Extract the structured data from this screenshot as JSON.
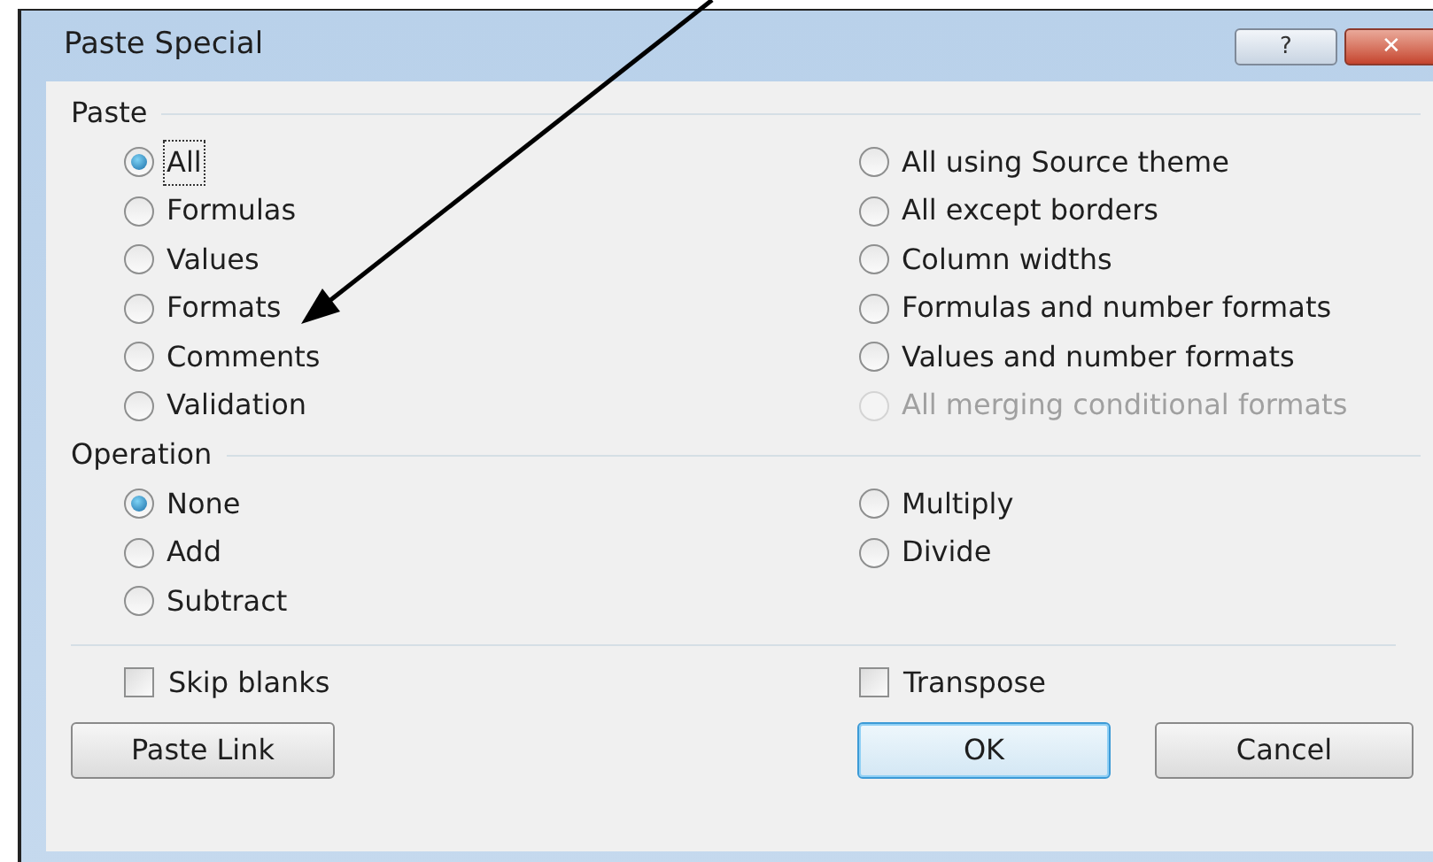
{
  "window": {
    "title": "Paste Special",
    "help_button": "?",
    "close_button": "✕"
  },
  "paste": {
    "title": "Paste",
    "options": [
      {
        "label": "All",
        "selected": true,
        "disabled": false,
        "focused": true
      },
      {
        "label": "All using Source theme",
        "selected": false,
        "disabled": false,
        "focused": false
      },
      {
        "label": "Formulas",
        "selected": false,
        "disabled": false,
        "focused": false
      },
      {
        "label": "All except borders",
        "selected": false,
        "disabled": false,
        "focused": false
      },
      {
        "label": "Values",
        "selected": false,
        "disabled": false,
        "focused": false
      },
      {
        "label": "Column widths",
        "selected": false,
        "disabled": false,
        "focused": false
      },
      {
        "label": "Formats",
        "selected": false,
        "disabled": false,
        "focused": false
      },
      {
        "label": "Formulas and number formats",
        "selected": false,
        "disabled": false,
        "focused": false
      },
      {
        "label": "Comments",
        "selected": false,
        "disabled": false,
        "focused": false
      },
      {
        "label": "Values and number formats",
        "selected": false,
        "disabled": false,
        "focused": false
      },
      {
        "label": "Validation",
        "selected": false,
        "disabled": false,
        "focused": false
      },
      {
        "label": "All merging conditional formats",
        "selected": false,
        "disabled": true,
        "focused": false
      }
    ]
  },
  "operation": {
    "title": "Operation",
    "options": [
      {
        "label": "None",
        "selected": true,
        "disabled": false,
        "focused": false
      },
      {
        "label": "Multiply",
        "selected": false,
        "disabled": false,
        "focused": false
      },
      {
        "label": "Add",
        "selected": false,
        "disabled": false,
        "focused": false
      },
      {
        "label": "Divide",
        "selected": false,
        "disabled": false,
        "focused": false
      },
      {
        "label": "Subtract",
        "selected": false,
        "disabled": false,
        "focused": false
      }
    ]
  },
  "checkboxes": [
    {
      "label": "Skip blanks",
      "checked": false
    },
    {
      "label": "Transpose",
      "checked": false
    }
  ],
  "buttons": {
    "paste_link": "Paste Link",
    "ok": "OK",
    "cancel": "Cancel"
  }
}
